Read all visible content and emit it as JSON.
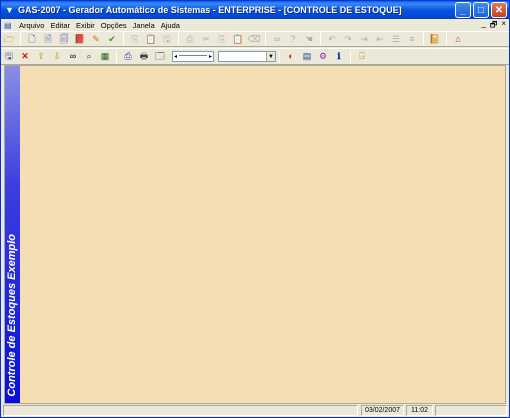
{
  "window": {
    "title": "GAS-2007 - Gerador Automático de Sistemas - ENTERPRISE - [CONTROLE DE ESTOQUE]",
    "minimize": "_",
    "maximize": "□",
    "close": "✕"
  },
  "menu": {
    "items": [
      "Arquivo",
      "Editar",
      "Exibir",
      "Opções",
      "Janela",
      "Ajuda"
    ],
    "mdi_minimize": "_",
    "mdi_restore": "🗗",
    "mdi_close": "×"
  },
  "toolbar1": {
    "icons": [
      "open-folder",
      "new-document",
      "document-list",
      "red-book",
      "pencil",
      "green-check",
      "copy-disabled",
      "paste-disabled",
      "save-disabled",
      "cut-disabled",
      "copy2-disabled",
      "paste2-disabled",
      "undo-disabled",
      "binoculars-disabled",
      "help-disabled",
      "redo-disabled",
      "indent-disabled",
      "outdent-disabled",
      "list-disabled",
      "list2-disabled",
      "book-purple",
      "home"
    ]
  },
  "toolbar2": {
    "icons": [
      "save",
      "delete",
      "import",
      "export",
      "binoculars",
      "find",
      "grid",
      "print-preview",
      "print",
      "page-setup",
      "slider",
      "combo",
      "palette",
      "list-view",
      "settings",
      "info",
      "exit"
    ],
    "combo_value": ""
  },
  "sidebar": {
    "label": "Controle de Estoques Exemplo"
  },
  "statusbar": {
    "date": "03/02/2007",
    "time": "11:02"
  },
  "colors": {
    "client_bg": "#F5DEB3",
    "sidebar_bottom": "#0A0FD6",
    "titlebar": "#0654E0"
  }
}
